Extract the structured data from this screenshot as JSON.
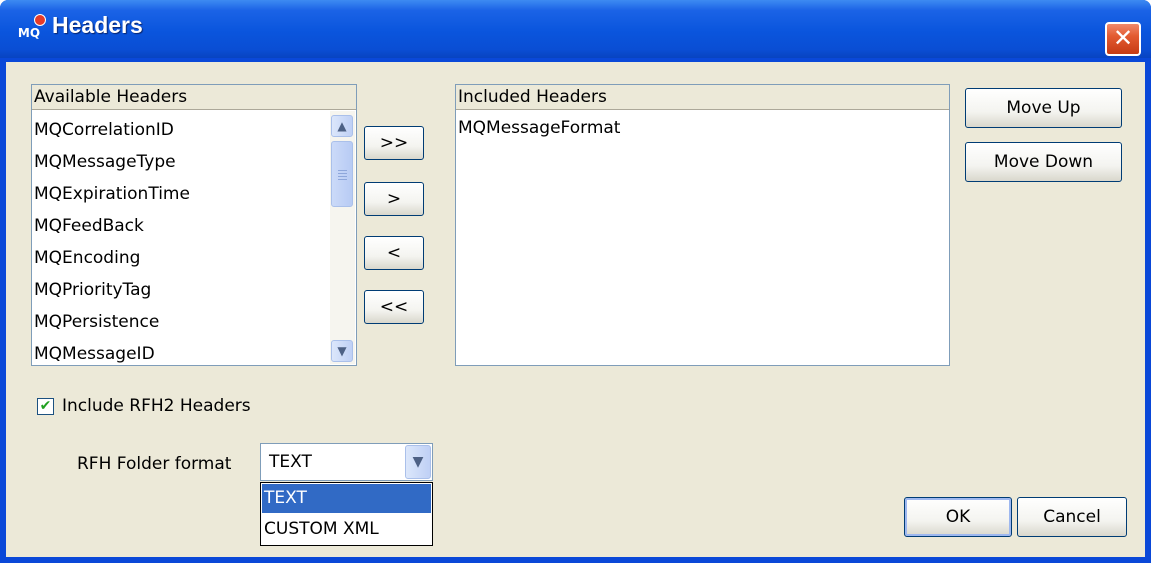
{
  "window": {
    "title": "Headers",
    "icon_label": "MQ",
    "close_glyph": "✕"
  },
  "available": {
    "header": "Available Headers",
    "items": [
      "MQCorrelationID",
      "MQMessageType",
      "MQExpirationTime",
      "MQFeedBack",
      "MQEncoding",
      "MQPriorityTag",
      "MQPersistence",
      "MQMessageID"
    ]
  },
  "transfer_buttons": {
    "add_all": ">>",
    "add": ">",
    "remove": "<",
    "remove_all": "<<"
  },
  "included": {
    "header": "Included Headers",
    "items": [
      "MQMessageFormat"
    ]
  },
  "order_buttons": {
    "move_up": "Move Up",
    "move_down": "Move Down"
  },
  "rfh2": {
    "checkbox_label": "Include RFH2 Headers",
    "checked": true,
    "check_glyph": "✔"
  },
  "folder_format": {
    "label": "RFH Folder format",
    "selected": "TEXT",
    "options": [
      "TEXT",
      "CUSTOM XML"
    ],
    "arrow_glyph": "▼"
  },
  "dialog_buttons": {
    "ok": "OK",
    "cancel": "Cancel"
  },
  "scroll_glyphs": {
    "up": "▲",
    "down": "▼"
  }
}
